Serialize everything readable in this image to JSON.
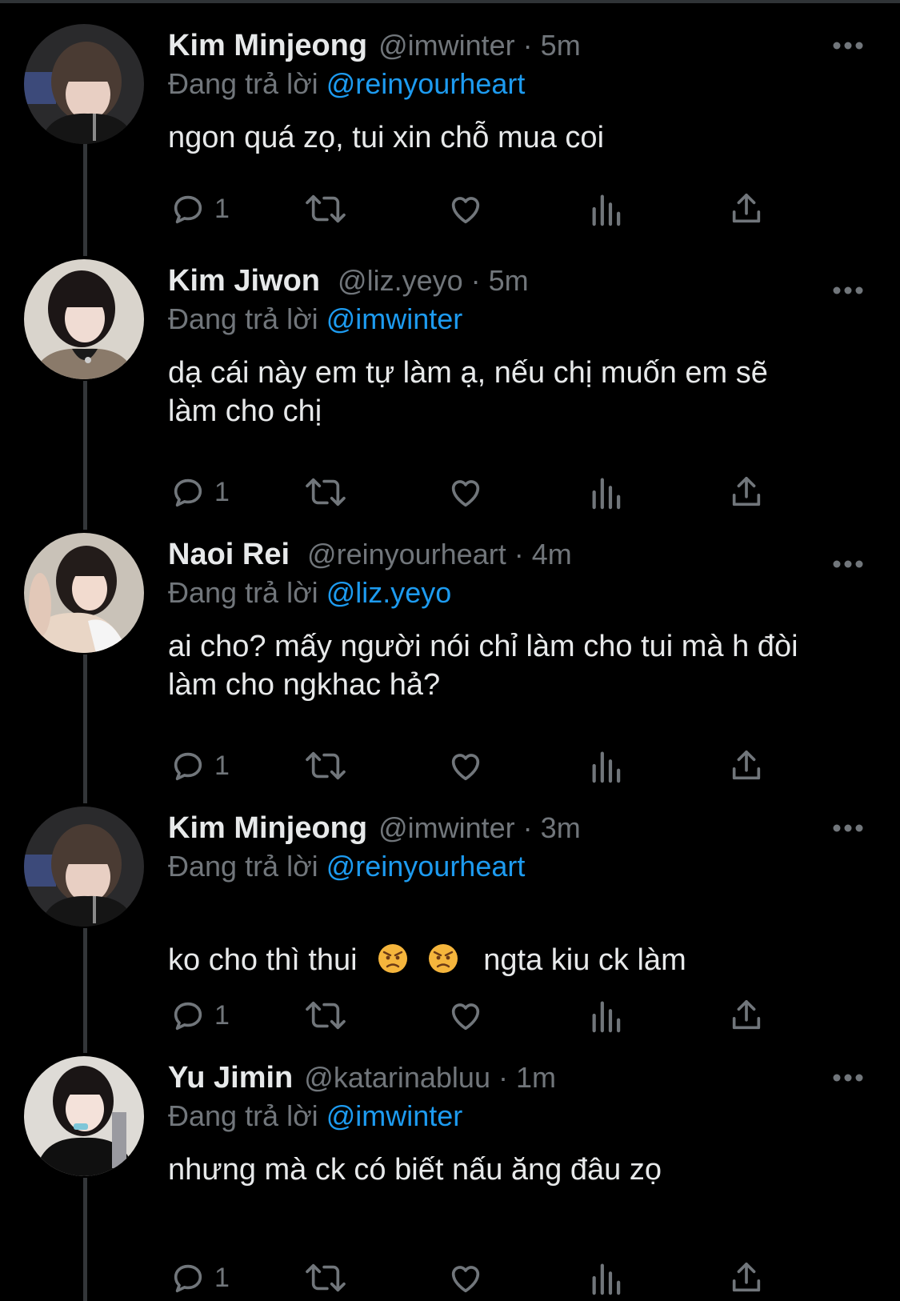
{
  "colors": {
    "background": "#000000",
    "text_primary": "#e7e9ea",
    "text_secondary": "#71767b",
    "mention": "#1d9bf0",
    "thread_line": "#333639",
    "angry_emoji": "#f5b53c"
  },
  "tweets": [
    {
      "name": "Kim Minjeong",
      "handle": "@imwinter",
      "time": "5m",
      "replying_prefix": "Đang trả lời",
      "replying_to": "@reinyourheart",
      "text_lines": [
        "ngon quá zọ, tui xin chỗ mua coi"
      ],
      "reply_count": "1",
      "avatar_icon": "avatar-photo"
    },
    {
      "name": "Kim Jiwon",
      "handle": "@liz.yeyo",
      "time": "5m",
      "replying_prefix": "Đang trả lời",
      "replying_to": "@imwinter",
      "text_lines": [
        "dạ cái này em tự làm ạ, nếu chị muốn em sẽ",
        "làm cho chị"
      ],
      "reply_count": "1",
      "avatar_icon": "avatar-photo"
    },
    {
      "name": "Naoi Rei",
      "handle": "@reinyourheart",
      "time": "4m",
      "replying_prefix": "Đang trả lời",
      "replying_to": "@liz.yeyo",
      "text_lines": [
        "ai cho? mấy người nói chỉ làm cho tui mà h đòi",
        "làm cho ngkhac hả?"
      ],
      "reply_count": "1",
      "avatar_icon": "avatar-photo"
    },
    {
      "name": "Kim Minjeong",
      "handle": "@imwinter",
      "time": "3m",
      "replying_prefix": "Đang trả lời",
      "replying_to": "@reinyourheart",
      "text_before_emoji": "ko cho thì thui",
      "emoji_icons": [
        "angry-face-emoji",
        "angry-face-emoji"
      ],
      "text_after_emoji": "ngta kiu ck làm",
      "reply_count": "1",
      "avatar_icon": "avatar-photo"
    },
    {
      "name": "Yu Jimin",
      "handle": "@katarinabluu",
      "time": "1m",
      "replying_prefix": "Đang trả lời",
      "replying_to": "@imwinter",
      "text_lines": [
        "nhưng mà ck có biết nấu ăng đâu zọ"
      ],
      "reply_count": "1",
      "avatar_icon": "avatar-photo"
    }
  ],
  "separator": "·",
  "action_icons": [
    "reply-icon",
    "retweet-icon",
    "like-icon",
    "views-icon",
    "share-icon"
  ],
  "more_icon": "more-options-icon"
}
